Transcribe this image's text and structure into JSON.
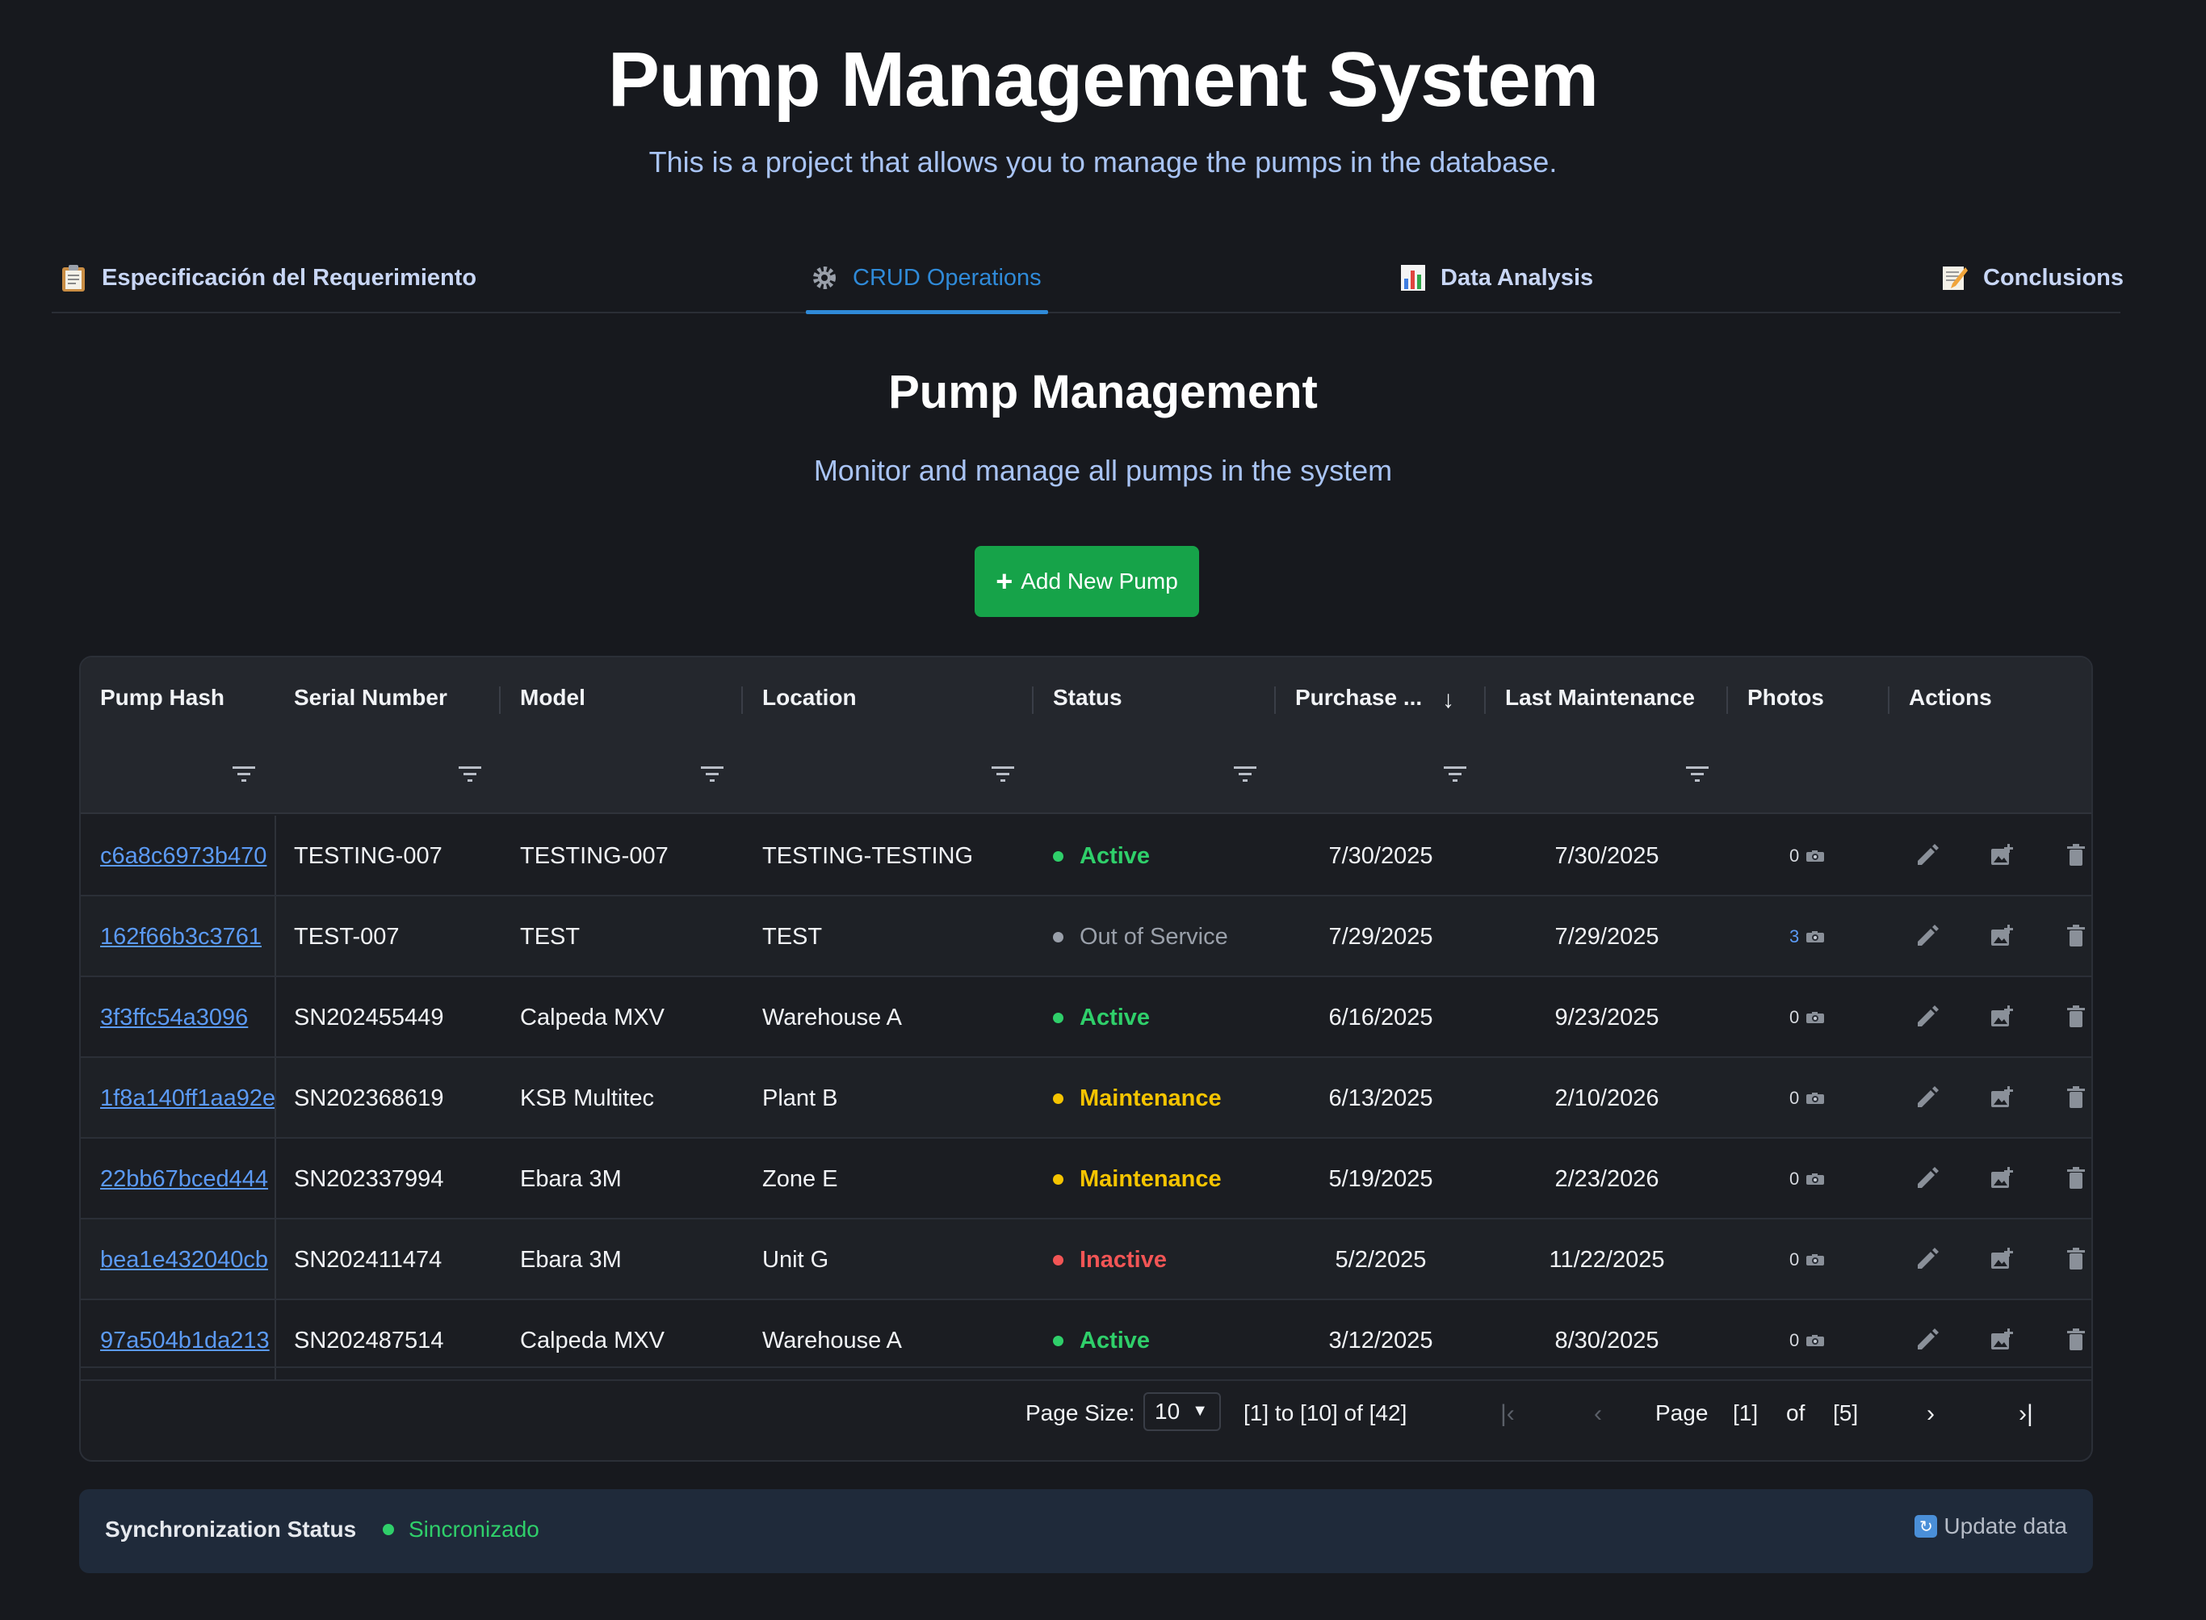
{
  "header": {
    "title": "Pump Management System",
    "subtitle": "This is a project that allows you to manage the pumps in the database."
  },
  "tabs": [
    {
      "label": "Especificación del Requerimiento",
      "icon": "clipboard-icon",
      "active": false
    },
    {
      "label": "CRUD Operations",
      "icon": "gear-icon",
      "active": true
    },
    {
      "label": "Data Analysis",
      "icon": "bar-chart-icon",
      "active": false
    },
    {
      "label": "Conclusions",
      "icon": "memo-icon",
      "active": false
    }
  ],
  "section": {
    "title": "Pump Management",
    "subtitle": "Monitor and manage all pumps in the system",
    "add_button": "Add New Pump"
  },
  "table": {
    "columns": [
      "Pump Hash",
      "Serial Number",
      "Model",
      "Location",
      "Status",
      "Purchase ...",
      "Last Maintenance",
      "Photos",
      "Actions"
    ],
    "rows": [
      {
        "hash": "c6a8c6973b470",
        "serial": "TESTING-007",
        "model": "TESTING-007",
        "location": "TESTING-TESTING",
        "status": "Active",
        "purchase": "7/30/2025",
        "maintenance": "7/30/2025",
        "photos": "0"
      },
      {
        "hash": "162f66b3c3761",
        "serial": "TEST-007",
        "model": "TEST",
        "location": "TEST",
        "status": "Out of Service",
        "purchase": "7/29/2025",
        "maintenance": "7/29/2025",
        "photos": "3"
      },
      {
        "hash": "3f3ffc54a3096",
        "serial": "SN202455449",
        "model": "Calpeda MXV",
        "location": "Warehouse A",
        "status": "Active",
        "purchase": "6/16/2025",
        "maintenance": "9/23/2025",
        "photos": "0"
      },
      {
        "hash": "1f8a140ff1aa92e",
        "serial": "SN202368619",
        "model": "KSB Multitec",
        "location": "Plant B",
        "status": "Maintenance",
        "purchase": "6/13/2025",
        "maintenance": "2/10/2026",
        "photos": "0"
      },
      {
        "hash": "22bb67bced444",
        "serial": "SN202337994",
        "model": "Ebara 3M",
        "location": "Zone E",
        "status": "Maintenance",
        "purchase": "5/19/2025",
        "maintenance": "2/23/2026",
        "photos": "0"
      },
      {
        "hash": "bea1e432040cb",
        "serial": "SN202411474",
        "model": "Ebara 3M",
        "location": "Unit G",
        "status": "Inactive",
        "purchase": "5/2/2025",
        "maintenance": "11/22/2025",
        "photos": "0"
      },
      {
        "hash": "97a504b1da213",
        "serial": "SN202487514",
        "model": "Calpeda MXV",
        "location": "Warehouse A",
        "status": "Active",
        "purchase": "3/12/2025",
        "maintenance": "8/30/2025",
        "photos": "0"
      }
    ],
    "status_colors": {
      "Active": "#2fcf6a",
      "Out of Service": "#9aa0aa",
      "Maintenance": "#f5c400",
      "Inactive": "#f25555"
    }
  },
  "pagination": {
    "page_size_label": "Page Size:",
    "page_size": "10",
    "range": "[1] to [10] of [42]",
    "page_label": "Page",
    "current_page": "[1]",
    "of_label": "of",
    "total_pages": "[5]"
  },
  "sync": {
    "label": "Synchronization Status",
    "status": "Sincronizado",
    "update_label": "Update data"
  }
}
